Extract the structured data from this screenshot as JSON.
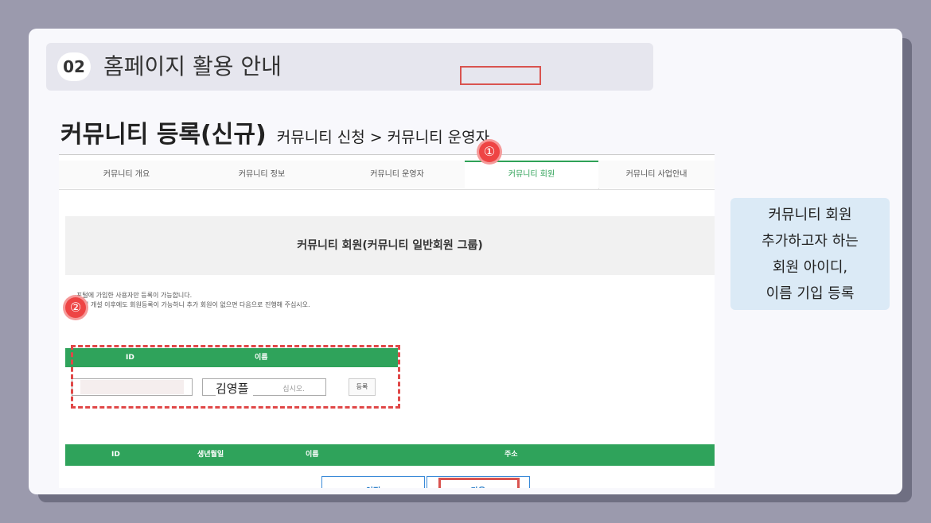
{
  "section": {
    "number": "02",
    "title": "홈페이지 활용 안내"
  },
  "page": {
    "title": "커뮤니티 등록(신규)",
    "breadcrumb": "커뮤니티 신청 > 커뮤니티 운영자"
  },
  "tabs": [
    {
      "label": "커뮤니티 개요",
      "active": false
    },
    {
      "label": "커뮤니티 정보",
      "active": false
    },
    {
      "label": "커뮤니티 운영자",
      "active": false
    },
    {
      "label": "커뮤니티 회원",
      "active": true
    },
    {
      "label": "커뮤니티 사업안내",
      "active": false
    }
  ],
  "markers": {
    "one": "①",
    "two": "②"
  },
  "panel_title": "커뮤니티 회원(커뮤니티 일반회원 그룹)",
  "notice": [
    "포털에 가입한 사용자만 등록이 가능합니다.",
    "티 개설 이후에도 회원등록이 가능하니 추가 회원이 없으면 다음으로 진행해 주십시오."
  ],
  "register_table": {
    "headers": {
      "id": "ID",
      "name": "이름"
    },
    "id_value": "",
    "name_value": "김영플",
    "name_placeholder_tail": "십시오.",
    "register_button": "등록"
  },
  "member_table": {
    "headers": [
      "ID",
      "생년월일",
      "이름",
      "주소"
    ]
  },
  "buttons": {
    "prev": "이전",
    "next": "다음"
  },
  "callout": {
    "lines": [
      "커뮤니티 회원",
      "추가하고자 하는",
      "회원 아이디,",
      "이름 기입 등록"
    ]
  },
  "colors": {
    "accent_green": "#2fa35b",
    "highlight_red": "#d9534f",
    "callout_bg": "#dbeaf6"
  }
}
